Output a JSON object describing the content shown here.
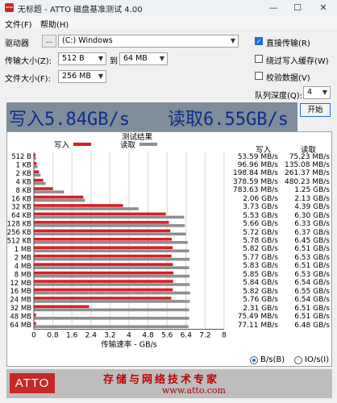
{
  "window": {
    "title": "无标题 - ATTO 磁盘基准测试 4.00",
    "app_icon": "ATTO",
    "minimize": "—",
    "maximize": "☐",
    "close": "✕"
  },
  "menu": {
    "file": "文件(F)",
    "help": "帮助(H)"
  },
  "settings": {
    "drive_label": "驱动器",
    "drive_browse": "...",
    "drive_value": "(C:) Windows",
    "transfer_label": "传输大小(Z):",
    "transfer_from": "512 B",
    "transfer_to_label": "到",
    "transfer_to": "64 MB",
    "file_size_label": "文件大小(F):",
    "file_size": "256 MB",
    "direct_io": "直接传输(R)",
    "bypass_cache": "绕过写入缓存(W)",
    "verify_data": "校验数据(V)",
    "queue_depth_label": "队列深度(Q):",
    "queue_depth": "4",
    "start_button": "开始"
  },
  "banner": {
    "write": "写入5.84GB/s",
    "read": "读取6.55GB/s"
  },
  "chart_data": {
    "type": "bar",
    "title": "测试结果",
    "xlabel": "传输速率 - GB/s",
    "xlim": [
      0,
      8
    ],
    "x_ticks": [
      "0",
      "0.8",
      "1.6",
      "2.4",
      "3.2",
      "4",
      "4.8",
      "5.6",
      "6.4",
      "7.2",
      "8"
    ],
    "categories": [
      "512 B",
      "1 KB",
      "2 KB",
      "4 KB",
      "8 KB",
      "16 KB",
      "32 KB",
      "64 KB",
      "128 KB",
      "256 KB",
      "512 KB",
      "1 MB",
      "2 MB",
      "4 MB",
      "8 MB",
      "12 MB",
      "16 MB",
      "24 MB",
      "32 MB",
      "48 MB",
      "64 MB"
    ],
    "series": [
      {
        "name": "写入",
        "color": "#d81f26",
        "values": [
          0.05359,
          0.09696,
          0.19884,
          0.37859,
          0.78363,
          2.06,
          3.73,
          5.53,
          5.66,
          5.72,
          5.78,
          5.82,
          5.77,
          5.83,
          5.85,
          5.84,
          5.82,
          5.76,
          2.31,
          0.07549,
          0.07711
        ]
      },
      {
        "name": "读取",
        "color": "#8f8f8f",
        "values": [
          0.07523,
          0.13508,
          0.26137,
          0.48023,
          1.25,
          2.13,
          4.39,
          6.3,
          6.33,
          6.37,
          6.45,
          6.51,
          6.53,
          6.51,
          6.53,
          6.54,
          6.55,
          6.54,
          6.51,
          6.51,
          6.48
        ]
      }
    ],
    "write_labels": [
      "53.59 MB/s",
      "96.96 MB/s",
      "198.84 MB/s",
      "378.59 MB/s",
      "783.63 MB/s",
      "2.06 GB/s",
      "3.73 GB/s",
      "5.53 GB/s",
      "5.66 GB/s",
      "5.72 GB/s",
      "5.78 GB/s",
      "5.82 GB/s",
      "5.77 GB/s",
      "5.83 GB/s",
      "5.85 GB/s",
      "5.84 GB/s",
      "5.82 GB/s",
      "5.76 GB/s",
      "2.31 GB/s",
      "75.49 MB/s",
      "77.11 MB/s"
    ],
    "read_labels": [
      "75.23 MB/s",
      "135.08 MB/s",
      "261.37 MB/s",
      "480.23 MB/s",
      "1.25 GB/s",
      "2.13 GB/s",
      "4.39 GB/s",
      "6.30 GB/s",
      "6.33 GB/s",
      "6.37 GB/s",
      "6.45 GB/s",
      "6.51 GB/s",
      "6.53 GB/s",
      "6.51 GB/s",
      "6.53 GB/s",
      "6.54 GB/s",
      "6.55 GB/s",
      "6.54 GB/s",
      "6.51 GB/s",
      "6.51 GB/s",
      "6.48 GB/s"
    ],
    "write_header": "写入",
    "read_header": "读取"
  },
  "units": {
    "bytes": "B/s(B)",
    "io": "IO/s(I)"
  },
  "footer": {
    "logo": "ATTO",
    "slogan": "存储与网络技术专家",
    "site": "www.atto.com"
  }
}
